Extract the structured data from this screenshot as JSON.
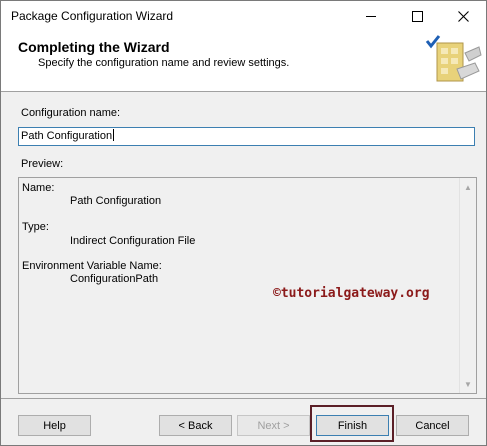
{
  "window": {
    "title": "Package Configuration Wizard"
  },
  "header": {
    "title": "Completing the Wizard",
    "subtitle": "Specify the configuration name and review settings."
  },
  "form": {
    "name_label": "Configuration name:",
    "name_value": "Path Configuration",
    "preview_label": "Preview:"
  },
  "preview": {
    "name_key": "Name:",
    "name_value": "Path Configuration",
    "type_key": "Type:",
    "type_value": "Indirect Configuration File",
    "env_key": "Environment Variable Name:",
    "env_value": "ConfigurationPath"
  },
  "watermark": "©tutorialgateway.org",
  "buttons": {
    "help": "Help",
    "back": "< Back",
    "next": "Next >",
    "finish": "Finish",
    "cancel": "Cancel"
  },
  "icons": {
    "minimize": "minimize-icon",
    "maximize": "maximize-icon",
    "close": "close-icon",
    "wizard": "wizard-checklist-icon"
  },
  "colors": {
    "input_border": "#3c7fb1",
    "finish_highlight": "#5b1f27",
    "watermark": "#8b1a1a"
  }
}
